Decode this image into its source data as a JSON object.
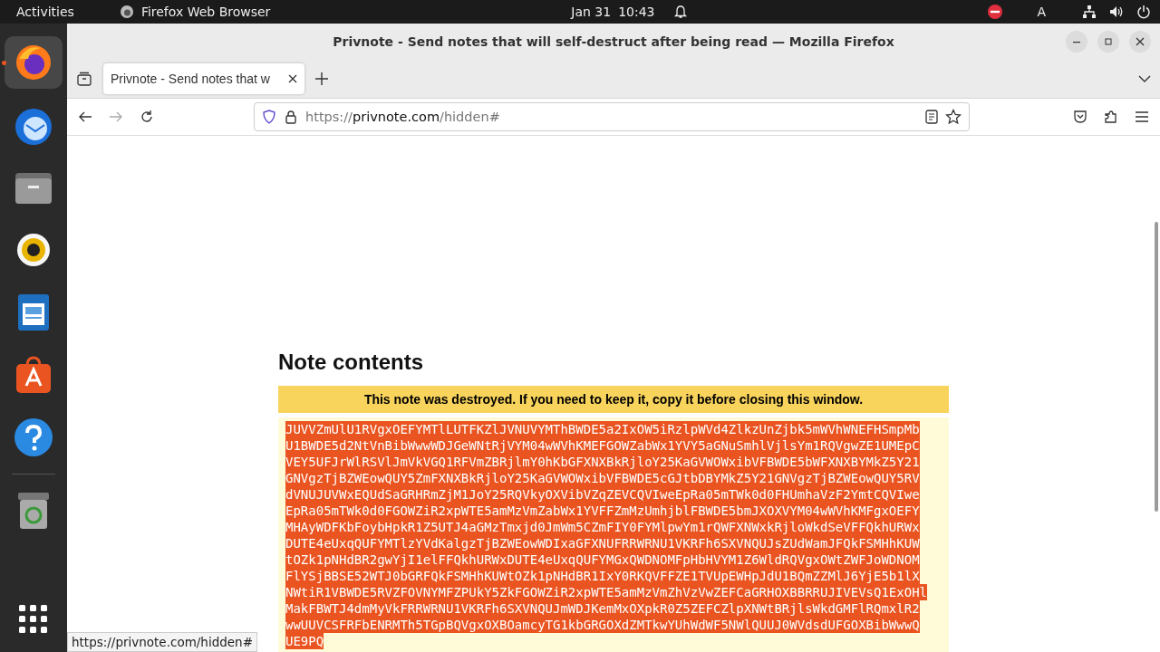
{
  "top_bar": {
    "activities": "Activities",
    "app_name": "Firefox Web Browser",
    "date": "Jan 31",
    "time": "10:43",
    "input_indicator": "A"
  },
  "dock": {
    "items": [
      {
        "kind": "firefox",
        "selected": true
      },
      {
        "kind": "mail",
        "selected": false
      },
      {
        "kind": "files",
        "selected": false
      },
      {
        "kind": "music",
        "selected": false
      },
      {
        "kind": "writer",
        "selected": false
      },
      {
        "kind": "store",
        "selected": false
      },
      {
        "kind": "help",
        "selected": false
      },
      {
        "kind": "trash",
        "selected": false
      }
    ]
  },
  "window": {
    "title": "Privnote - Send notes that will self-destruct after being read — Mozilla Firefox"
  },
  "tabs": [
    {
      "label": "Privnote - Send notes that w",
      "selected": true
    }
  ],
  "address_bar": {
    "scheme": "https://",
    "host": "privnote.com",
    "path": "/hidden#"
  },
  "page": {
    "heading": "Note contents",
    "banner": "This note was destroyed. If you need to keep it, copy it before closing this window.",
    "note": {
      "selected": true,
      "lines": [
        "JUVVZmUlU1RVgxOEFYMTlLUTFKZlJVNUVYMThBWDE5a2IxOW5iRzlpWVd4ZlkzUnZjbk5mWVhWNEFHSmpMb",
        "U1BWDE5d2NtVnBibWwwWDJGeWNtRjVYM04wWVhKMEFGOWZabWx1YVY5aGNuSmhlVjlsYm1RQVgwZE1UMEpC",
        "VEY5UFJrWlRSVlJmVkVGQ1RFVmZBRjlmY0hKbGFXNXBkRjloY25KaGVWOWxibVFBWDE5bWFXNXBYMkZ5Y21",
        "GNVgzTjBZWEowQUY5ZmFXNXBkRjloY25KaGVWOWxibVFBWDE5cGJtbDBYMkZ5Y21GNVgzTjBZWEowQUY5RV",
        "dVNUJUVWxEQUdSaGRHRmZjM1JoY25RQVkyOXVibVZqZEVCQVIweEpRa05mTWk0d0FHUmhaVzF2YmtCQVIwe",
        "EpRa05mTWk0d0FGOWZiR2xpWTE5amMzVmZabWx1YVFFZmMzUmhjblFBWDE5bmJXOXVYM04wWVhKMFgxOEFY",
        "MHAyWDFKbFoybHpkR1Z5UTJ4aGMzTmxjd0JmWm5CZmFIY0FYMlpwYm1rQWFXNWxkRjloWkdSeVFFQkhURWx",
        "DUTE4eUxqQUFYMTlzYVdKalgzTjBZWEowWDIxaGFXNUFRRWRNU1VKRFh6SXVNQUJsZUdWamJFQkFSMHhKUW",
        "tOZk1pNHdBR2gwYjI1elFFQkhURWxDUTE4eUxqQUFYMGxQWDNOMFpHbHVYM1Z6WldRQVgxOWtZWFJoWDNOM",
        "FlYSjBBSE52WTJ0bGRFQkFSMHhKUWtOZk1pNHdBR1IxY0RKQVFFZE1TVUpEWHpJdU1BQmZZMlJ6YjE5b1lX",
        "NWtiR1VBWDE5RVZFOVNYMFZPUkY5ZkFGOWZiR2xpWTE5amMzVmZhVzVwZEFCaGRHOXBBRRUJIVEVsQ1ExOHl",
        "MakFBWTJ4dmMyVkFRRWRNU1VKRFh6SXVNQUJmWDJKemMxOXpkR0Z5ZEFCZlpXNWtBRjlsWkdGMFlRQmxlR2",
        "wwUUVCSFRFbENRMTh5TGpBQVgxOXBOamcyTG1kbGRGOXdZMTkwYUhWdWF5NWlQUUJ0WVdsdUFGOXBibWwwQ",
        "UE9PQ"
      ]
    }
  },
  "status_bar": {
    "url": "https://privnote.com/hidden#"
  }
}
